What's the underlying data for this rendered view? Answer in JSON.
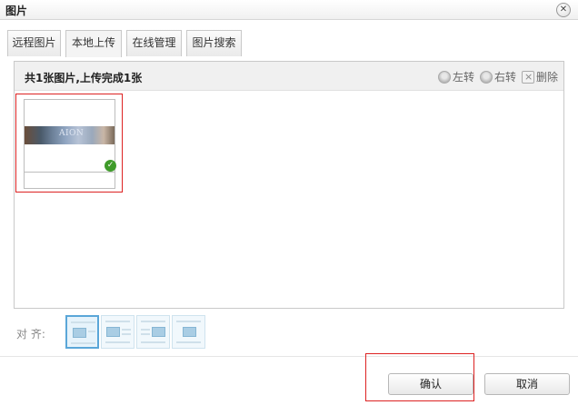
{
  "dialog": {
    "title": "图片"
  },
  "tabs": [
    {
      "label": "远程图片",
      "active": false
    },
    {
      "label": "本地上传",
      "active": true
    },
    {
      "label": "在线管理",
      "active": false
    },
    {
      "label": "图片搜索",
      "active": false
    }
  ],
  "upload": {
    "status": "共1张图片,上传完成1张",
    "actions": {
      "rotate_left": "左转",
      "rotate_right": "右转",
      "delete": "删除"
    },
    "thumbnail": {
      "caption": "AION",
      "uploaded": true
    }
  },
  "align": {
    "label": "对 齐:",
    "options": [
      "none",
      "left",
      "right",
      "center"
    ],
    "selected": "none"
  },
  "buttons": {
    "confirm": "确认",
    "cancel": "取消"
  },
  "colors": {
    "highlight": "#dd2222",
    "success": "#3f9b2a",
    "align_selected": "#5aa6d8"
  }
}
